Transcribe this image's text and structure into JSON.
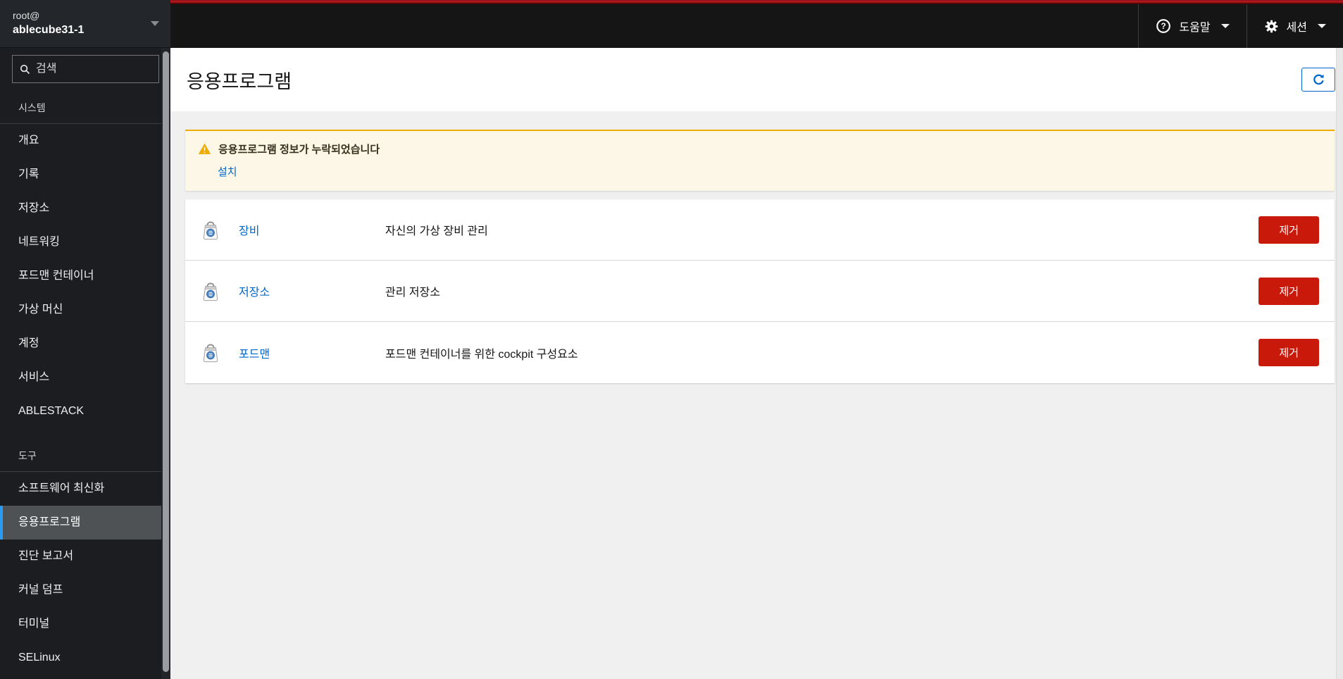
{
  "masthead": {
    "host_user": "root@",
    "host_name": "ablecube31-1",
    "help_label": "도움말",
    "session_label": "세션"
  },
  "sidebar": {
    "search_placeholder": "검색",
    "section_system": "시스템",
    "section_tools": "도구",
    "system_items": [
      "개요",
      "기록",
      "저장소",
      "네트워킹",
      "포드맨 컨테이너",
      "가상 머신",
      "계정",
      "서비스",
      "ABLESTACK"
    ],
    "tools_items": [
      "소프트웨어 최신화",
      "응용프로그램",
      "진단 보고서",
      "커널 덤프",
      "터미널",
      "SELinux"
    ],
    "active_item": "응용프로그램"
  },
  "page": {
    "title": "응용프로그램"
  },
  "alert": {
    "title": "응용프로그램 정보가 누락되었습니다",
    "action_label": "설치"
  },
  "apps": [
    {
      "name": "장비",
      "description": "자신의 가상 장비 관리",
      "remove_label": "제거"
    },
    {
      "name": "저장소",
      "description": "관리 저장소",
      "remove_label": "제거"
    },
    {
      "name": "포드맨",
      "description": "포드맨 컨테이너를 위한 cockpit 구성요소",
      "remove_label": "제거"
    }
  ],
  "colors": {
    "brand_stripe": "#c21a1f",
    "masthead_bg": "#151515",
    "sidebar_bg": "#1b1d21",
    "sidebar_active_bg": "#4f5255",
    "sidebar_active_border": "#2b9af3",
    "link": "#0066cc",
    "danger": "#c9190b",
    "warning_accent": "#f0ab00",
    "warning_bg": "#fdf7e7"
  }
}
